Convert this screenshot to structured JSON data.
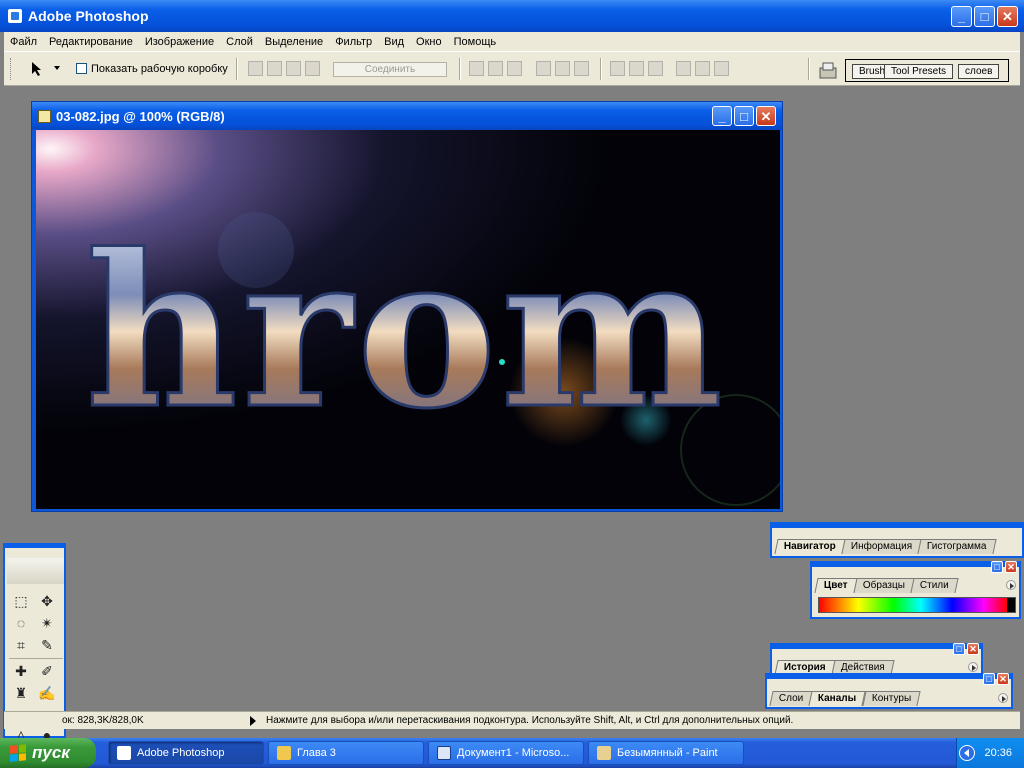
{
  "app": {
    "title": "Adobe Photoshop",
    "icon": "photoshop-icon",
    "window_buttons": {
      "minimize": "_",
      "maximize": "□",
      "close": "✕"
    }
  },
  "menu": {
    "items": [
      "Файл",
      "Редактирование",
      "Изображение",
      "Слой",
      "Выделение",
      "Фильтр",
      "Вид",
      "Окно",
      "Помощь"
    ]
  },
  "options": {
    "show_bounding_box_label": "Показать рабочую коробку",
    "show_bounding_box_checked": false,
    "combine_label": "Соединить",
    "palette_well_tabs": [
      "Brushe",
      "Tool Presets",
      "слоев"
    ]
  },
  "document": {
    "title": "03-082.jpg @ 100% (RGB/8)",
    "canvas_text": "hrom"
  },
  "status": {
    "doc_info": "ок: 828,3K/828,0K",
    "hint": "Нажмите для выбора и/или перетаскивания подконтура.  Используйте Shift, Alt, и Ctrl для дополнительных опций."
  },
  "palettes": {
    "navigator": {
      "tabs": [
        "Навигатор",
        "Информация",
        "Гистограмма"
      ],
      "active": 0
    },
    "color": {
      "tabs": [
        "Цвет",
        "Образцы",
        "Стили"
      ],
      "active": 0
    },
    "history": {
      "tabs": [
        "История",
        "Действия"
      ],
      "active": 0
    },
    "layers": {
      "tabs": [
        "Слои",
        "Каналы",
        "Контуры"
      ],
      "active": 1
    }
  },
  "taskbar": {
    "start_label": "пуск",
    "tasks": [
      {
        "label": "Adobe Photoshop",
        "icon": "photoshop-icon",
        "active": true
      },
      {
        "label": "Глава 3",
        "icon": "folder-icon",
        "active": false
      },
      {
        "label": "Документ1 - Microso...",
        "icon": "word-icon",
        "active": false
      },
      {
        "label": "Безымянный - Paint",
        "icon": "paint-icon",
        "active": false
      }
    ],
    "clock": "20:36"
  },
  "colors": {
    "xp_blue": "#0a5fe8",
    "xp_green": "#3a9a3a",
    "chrome_face": "#ece9d8",
    "workspace_gray": "#7f7f7f",
    "close_red": "#c9381a"
  }
}
